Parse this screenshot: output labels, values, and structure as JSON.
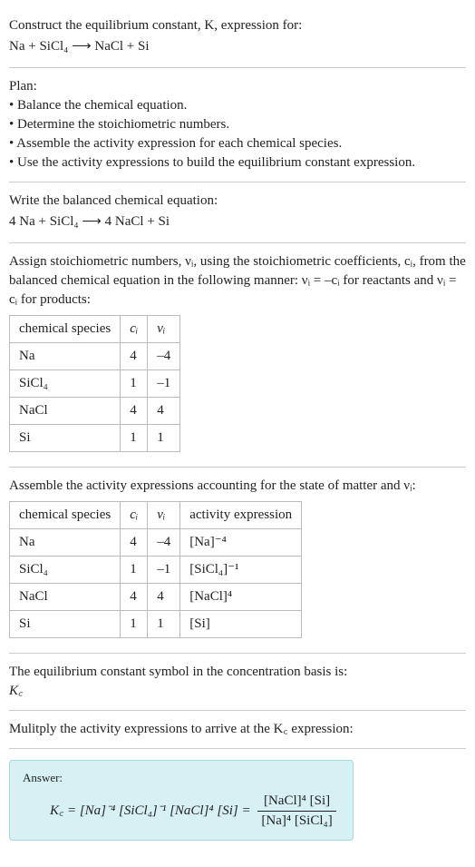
{
  "intro": {
    "prompt": "Construct the equilibrium constant, K, expression for:",
    "equation": "Na + SiCl₄  ⟶  NaCl + Si"
  },
  "plan": {
    "heading": "Plan:",
    "b1": "• Balance the chemical equation.",
    "b2": "• Determine the stoichiometric numbers.",
    "b3": "• Assemble the activity expression for each chemical species.",
    "b4": "• Use the activity expressions to build the equilibrium constant expression."
  },
  "balance": {
    "heading": "Write the balanced chemical equation:",
    "equation": "4 Na + SiCl₄  ⟶  4 NaCl + Si"
  },
  "assign": {
    "text": "Assign stoichiometric numbers, νᵢ, using the stoichiometric coefficients, cᵢ, from the balanced chemical equation in the following manner: νᵢ = –cᵢ for reactants and νᵢ = cᵢ for products:",
    "h_species": "chemical species",
    "h_ci": "cᵢ",
    "h_vi": "νᵢ",
    "rows": [
      {
        "sp": "Na",
        "ci": "4",
        "vi": "–4"
      },
      {
        "sp": "SiCl₄",
        "ci": "1",
        "vi": "–1"
      },
      {
        "sp": "NaCl",
        "ci": "4",
        "vi": "4"
      },
      {
        "sp": "Si",
        "ci": "1",
        "vi": "1"
      }
    ]
  },
  "assemble": {
    "text": "Assemble the activity expressions accounting for the state of matter and νᵢ:",
    "h_species": "chemical species",
    "h_ci": "cᵢ",
    "h_vi": "νᵢ",
    "h_act": "activity expression",
    "rows": [
      {
        "sp": "Na",
        "ci": "4",
        "vi": "–4",
        "act": "[Na]⁻⁴"
      },
      {
        "sp": "SiCl₄",
        "ci": "1",
        "vi": "–1",
        "act": "[SiCl₄]⁻¹"
      },
      {
        "sp": "NaCl",
        "ci": "4",
        "vi": "4",
        "act": "[NaCl]⁴"
      },
      {
        "sp": "Si",
        "ci": "1",
        "vi": "1",
        "act": "[Si]"
      }
    ]
  },
  "symbol": {
    "text": "The equilibrium constant symbol in the concentration basis is:",
    "val": "K꜀"
  },
  "mult": {
    "text": "Mulitply the activity expressions to arrive at the K꜀ expression:"
  },
  "answer": {
    "label": "Answer:",
    "lhs": "K꜀ = [Na]⁻⁴ [SiCl₄]⁻¹ [NaCl]⁴ [Si] = ",
    "num": "[NaCl]⁴ [Si]",
    "den": "[Na]⁴ [SiCl₄]"
  }
}
